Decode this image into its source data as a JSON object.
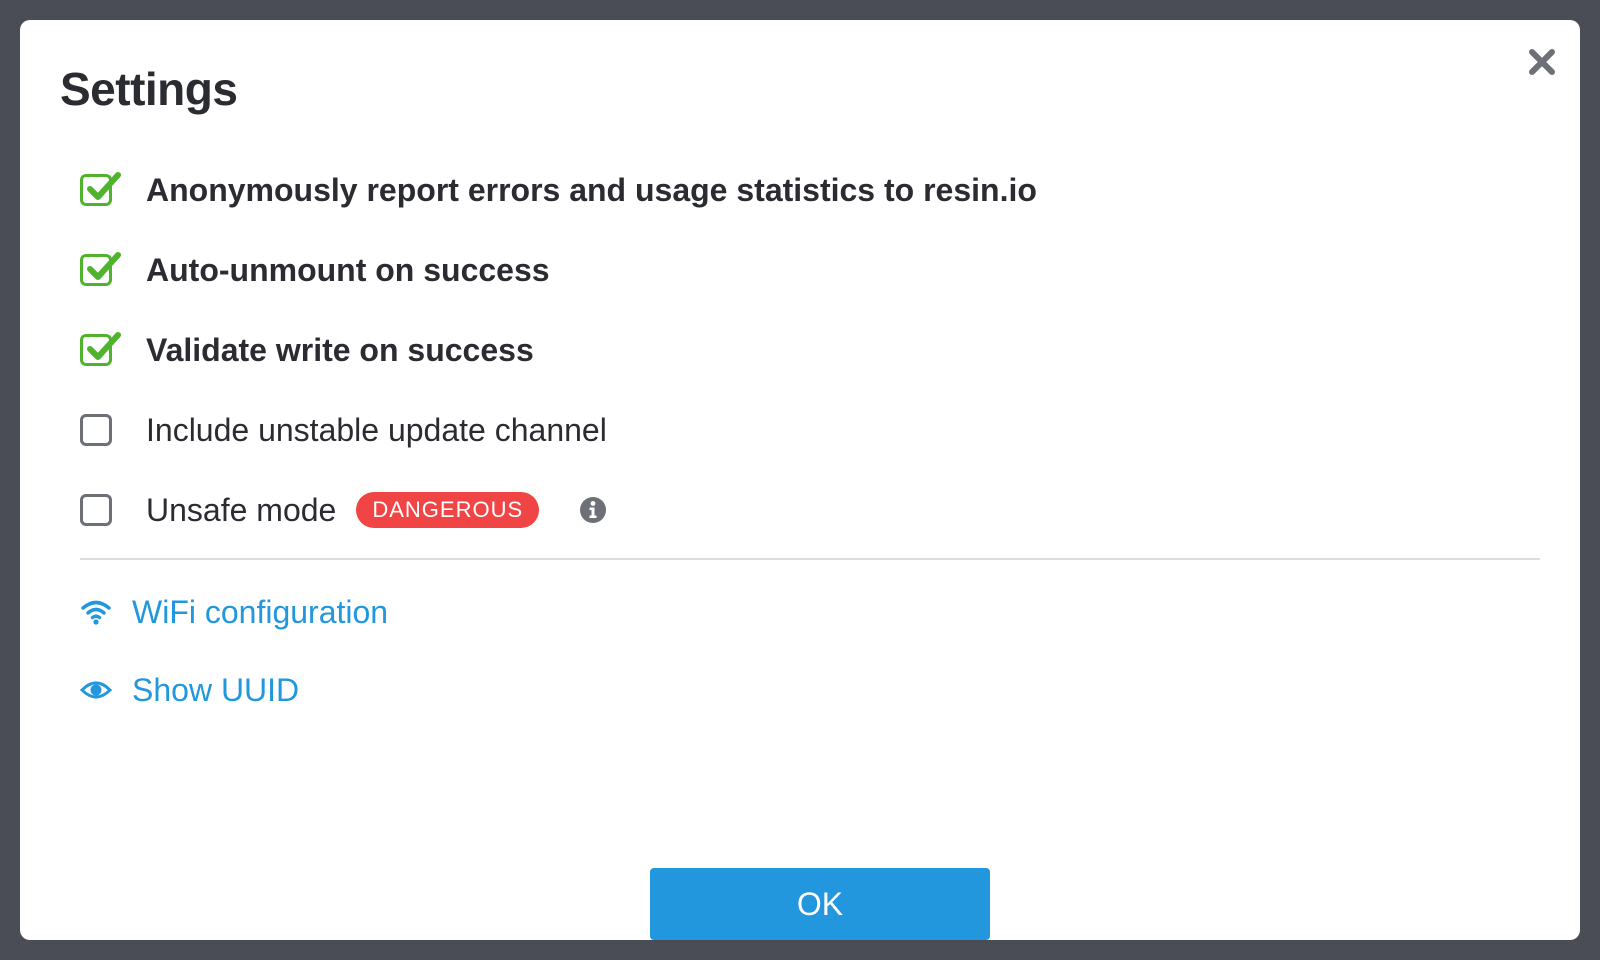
{
  "dialog": {
    "title": "Settings",
    "close_icon": "close-icon"
  },
  "options": [
    {
      "label": "Anonymously report errors and usage statistics to resin.io",
      "checked": true
    },
    {
      "label": "Auto-unmount on success",
      "checked": true
    },
    {
      "label": "Validate write on success",
      "checked": true
    },
    {
      "label": "Include unstable update channel",
      "checked": false
    },
    {
      "label": "Unsafe mode",
      "checked": false,
      "badge": "DANGEROUS",
      "info_icon": "info-icon"
    }
  ],
  "links": [
    {
      "label": "WiFi configuration",
      "icon": "wifi-icon"
    },
    {
      "label": "Show UUID",
      "icon": "eye-icon"
    }
  ],
  "footer": {
    "ok_label": "OK"
  },
  "colors": {
    "accent": "#2297de",
    "check": "#4fb32e",
    "danger": "#f14545",
    "backdrop": "#4a4d55",
    "text": "#2a2c31"
  }
}
